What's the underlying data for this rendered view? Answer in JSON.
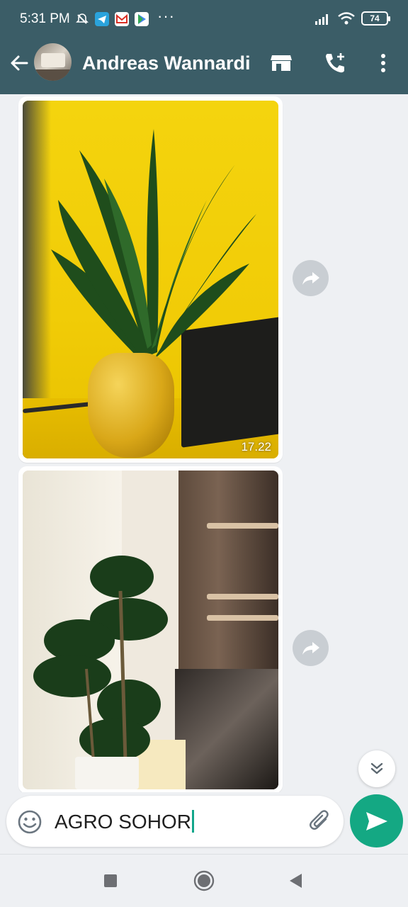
{
  "status_bar": {
    "time": "5:31 PM",
    "dots": "···",
    "battery": "74",
    "icons": [
      "mute-icon",
      "telegram-icon",
      "gmail-icon",
      "play-store-icon",
      "signal-icon",
      "wifi-icon"
    ]
  },
  "app_bar": {
    "contact_name": "Andreas Wannardi",
    "icons": [
      "back-arrow-icon",
      "store-icon",
      "add-call-icon",
      "more-vert-icon"
    ]
  },
  "messages": [
    {
      "type": "image",
      "time": "17.22"
    },
    {
      "type": "image",
      "time": ""
    }
  ],
  "composer": {
    "value": "AGRO SOHOR",
    "accent": "#14a883"
  },
  "colors": {
    "header": "#3b5d67",
    "chat_bg": "#eef0f3",
    "send": "#14a883"
  },
  "navigation": [
    "recents-button",
    "home-button",
    "back-button"
  ]
}
